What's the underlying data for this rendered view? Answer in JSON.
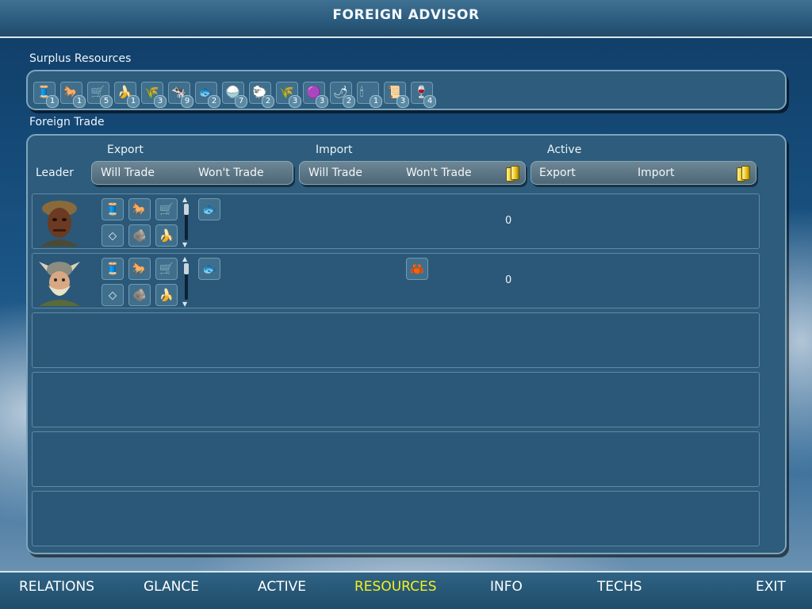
{
  "header": {
    "title": "FOREIGN ADVISOR"
  },
  "surplus": {
    "label": "Surplus Resources",
    "items": [
      {
        "icon": "silk-spool-icon",
        "glyph": "🧵",
        "count": "1"
      },
      {
        "icon": "horse-icon",
        "glyph": "🐎",
        "count": "1"
      },
      {
        "icon": "wagon-icon",
        "glyph": "🛒",
        "count": "5"
      },
      {
        "icon": "banana-icon",
        "glyph": "🍌",
        "count": "1"
      },
      {
        "icon": "sugar-cane-icon",
        "glyph": "🌾",
        "count": "3"
      },
      {
        "icon": "cattle-icon",
        "glyph": "🐄",
        "count": "9"
      },
      {
        "icon": "fish-icon",
        "glyph": "🐟",
        "count": "2"
      },
      {
        "icon": "rice-bowl-icon",
        "glyph": "🍚",
        "count": "7"
      },
      {
        "icon": "sheep-icon",
        "glyph": "🐑",
        "count": "2"
      },
      {
        "icon": "wheat-icon",
        "glyph": "🌾",
        "count": "3"
      },
      {
        "icon": "dye-icon",
        "glyph": "🟣",
        "count": "3"
      },
      {
        "icon": "spice-icon",
        "glyph": "🌶",
        "count": "2"
      },
      {
        "icon": "incense-icon",
        "glyph": "🕯",
        "count": "1"
      },
      {
        "icon": "paper-icon",
        "glyph": "📜",
        "count": "3"
      },
      {
        "icon": "wine-icon",
        "glyph": "🍷",
        "count": "4"
      }
    ]
  },
  "trade": {
    "label": "Foreign Trade",
    "leader_label": "Leader",
    "export": {
      "heading": "Export",
      "will": "Will Trade",
      "wont": "Won't Trade"
    },
    "import": {
      "heading": "Import",
      "will": "Will Trade",
      "wont": "Won't Trade"
    },
    "active": {
      "heading": "Active",
      "export": "Export",
      "import": "Import"
    },
    "rows": [
      {
        "portrait": "african-leader-portrait",
        "export_will": [
          "🧵",
          "🐎",
          "🛒",
          "⬦",
          "🪨",
          "🍌"
        ],
        "export_wont": [
          "🐟"
        ],
        "import_will": [],
        "gold": "0"
      },
      {
        "portrait": "viking-leader-portrait",
        "export_will": [
          "🧵",
          "🐎",
          "🛒",
          "⬦",
          "🪨",
          "🍌"
        ],
        "export_wont": [
          "🐟"
        ],
        "import_wont": [
          "🦀"
        ],
        "gold": "0"
      }
    ]
  },
  "nav": {
    "relations": "RELATIONS",
    "glance": "GLANCE",
    "active": "ACTIVE",
    "resources": "RESOURCES",
    "info": "INFO",
    "techs": "TECHS",
    "exit": "EXIT"
  }
}
